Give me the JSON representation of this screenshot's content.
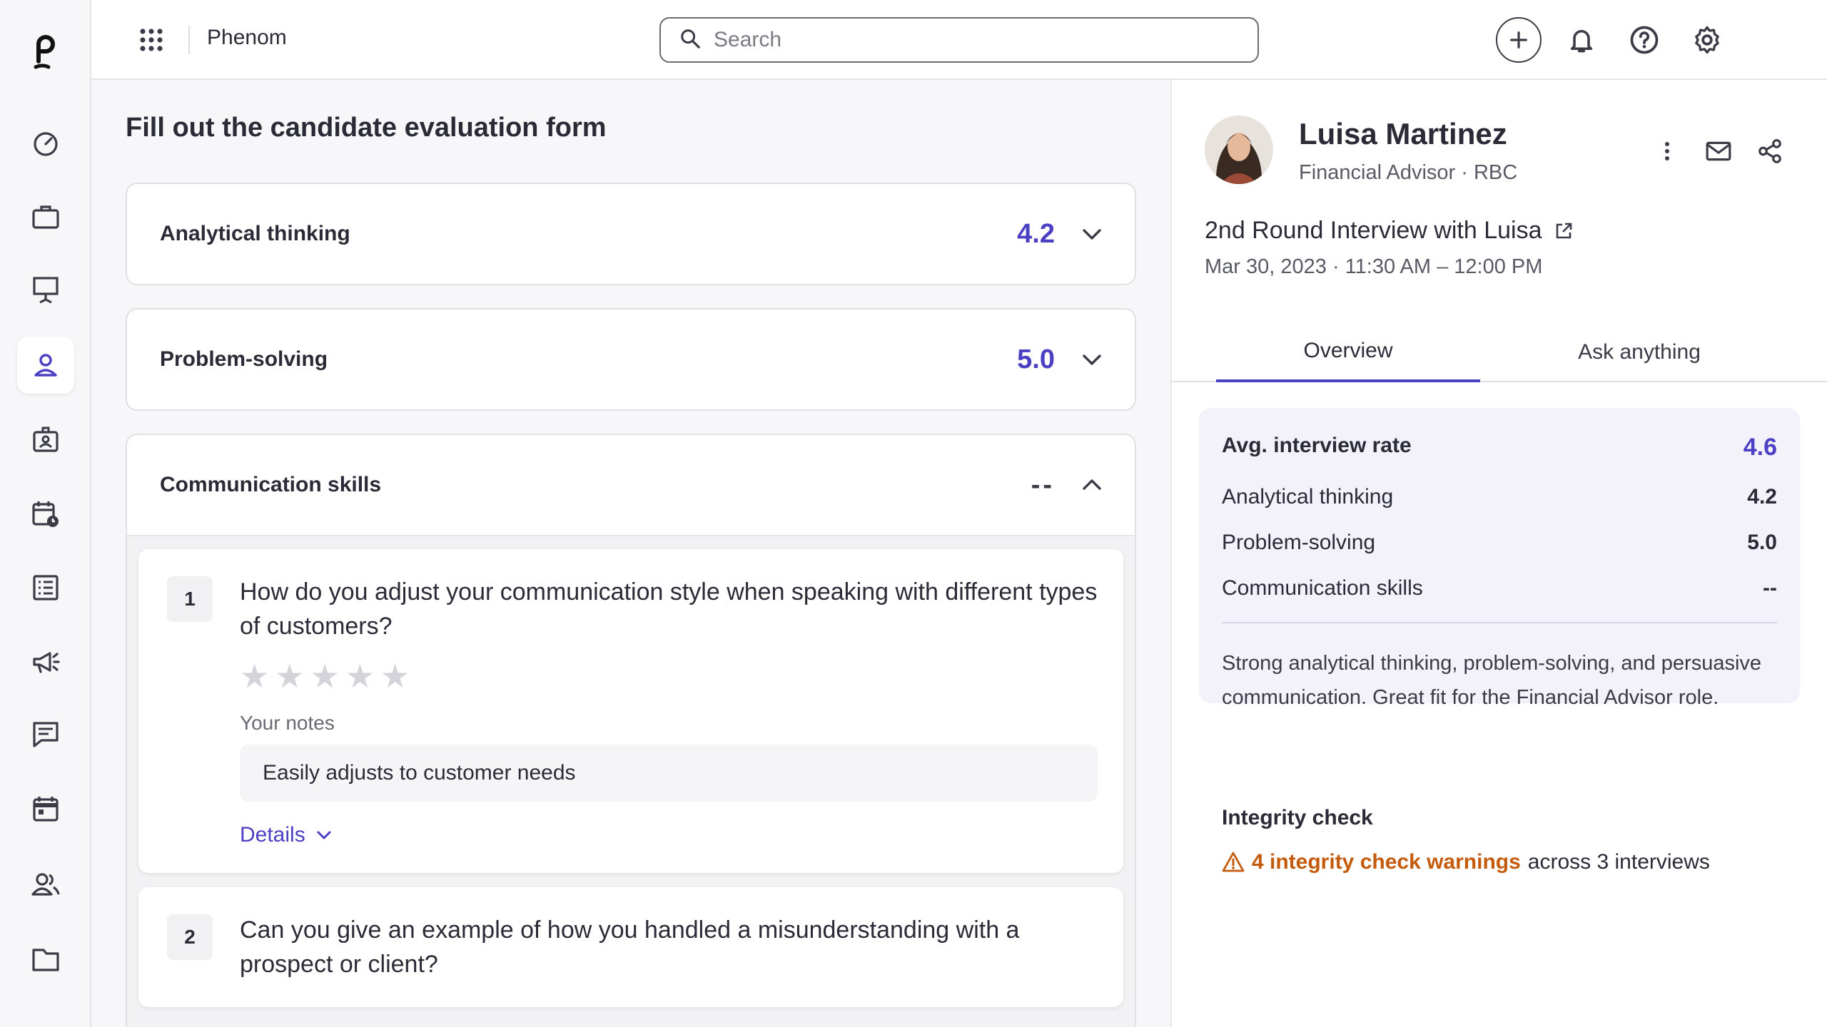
{
  "topbar": {
    "app_name": "Phenom",
    "search_placeholder": "Search"
  },
  "main": {
    "title": "Fill out the candidate evaluation form",
    "sections": [
      {
        "title": "Analytical thinking",
        "score": "4.2",
        "expanded": false
      },
      {
        "title": "Problem-solving",
        "score": "5.0",
        "expanded": false
      },
      {
        "title": "Communication skills",
        "score": "--",
        "expanded": true
      }
    ],
    "questions": [
      {
        "number": "1",
        "text": "How do you adjust your communication style when speaking with different types of customers?",
        "rating": 0,
        "max_rating": 5,
        "notes_label": "Your notes",
        "notes_value": "Easily adjusts to customer needs",
        "details_label": "Details"
      },
      {
        "number": "2",
        "text": "Can you give an example of how you handled a misunderstanding with a prospect or client?"
      }
    ]
  },
  "panel": {
    "candidate_name": "Luisa Martinez",
    "candidate_subtitle": "Financial Advisor · RBC",
    "interview_title": "2nd Round Interview with Luisa",
    "interview_date": "Mar 30, 2023 · 11:30 AM – 12:00 PM",
    "tabs": [
      "Overview",
      "Ask anything"
    ],
    "active_tab": "Overview",
    "summary": {
      "head_label": "Avg. interview rate",
      "head_value": "4.6",
      "rows": [
        {
          "label": "Analytical thinking",
          "value": "4.2"
        },
        {
          "label": "Problem-solving",
          "value": "5.0"
        },
        {
          "label": "Communication skills",
          "value": "--"
        }
      ],
      "text": "Strong analytical thinking, problem-solving, and persuasive communication. Great fit for the Financial Advisor role."
    },
    "integrity": {
      "title": "Integrity check",
      "warning_link": "4 integrity check warnings",
      "warning_suffix": "across 3 interviews"
    }
  },
  "colors": {
    "accent": "#4b3fc4",
    "warning": "#c45a0b",
    "summary_bg": "#f3f2fb"
  },
  "icons": {
    "rail": [
      "phenom-logo",
      "dashboard-icon",
      "briefcase-icon",
      "presentation-icon",
      "person-icon",
      "id-badge-icon",
      "calendar-clock-icon",
      "list-icon",
      "megaphone-icon",
      "chat-icon",
      "calendar-icon",
      "people-icon",
      "folder-icon"
    ],
    "top": [
      "apps-grid-icon",
      "search-icon",
      "plus-icon",
      "bell-icon",
      "help-icon",
      "gear-icon",
      "user-avatar"
    ],
    "panel": [
      "more-vertical-icon",
      "mail-icon",
      "share-icon",
      "external-link-icon",
      "warning-icon"
    ]
  }
}
